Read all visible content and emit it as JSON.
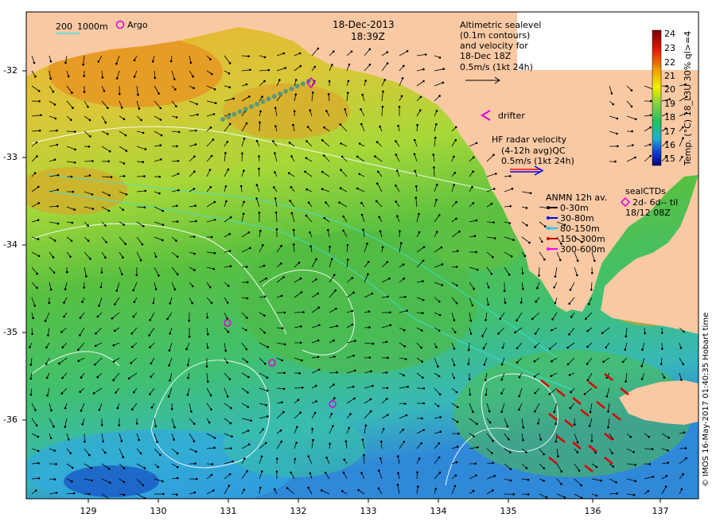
{
  "header": {
    "date": "18-Dec-2013",
    "time": "18:39Z"
  },
  "legend_isobath": {
    "depth1": "200",
    "depth2": "1000m"
  },
  "legend_argo": {
    "label": "Argo"
  },
  "altimetry_note": {
    "lines": [
      "Altimetric sealevel",
      "(0.1m contours)",
      "and velocity for",
      "18-Dec 18Z",
      "0.5m/s (1kt 24h)"
    ]
  },
  "drifter_legend": {
    "label": "drifter"
  },
  "hf_radar": {
    "lines": [
      "HF radar velocity",
      "(4-12h avg)QC",
      "0.5m/s (1kt 24h)"
    ]
  },
  "anmn": {
    "title": "ANMN 12h av.",
    "items": [
      {
        "label": "0-30m",
        "color": "#000000"
      },
      {
        "label": "30-80m",
        "color": "#0000ff"
      },
      {
        "label": "80-150m",
        "color": "#00c8ff"
      },
      {
        "label": "150-300m",
        "color": "#cc0000"
      },
      {
        "label": "300-600m",
        "color": "#ff00ff"
      }
    ]
  },
  "seal_ctds": {
    "title": "sealCTDs",
    "line2": "2d- 6d-- til",
    "line3": "18/12 08Z"
  },
  "colorbar": {
    "title": "Temp. (°C) 18_L3U 30% ql>=4",
    "ticks": [
      "24",
      "23",
      "22",
      "21",
      "20",
      "19",
      "18",
      "17",
      "16",
      "15"
    ]
  },
  "copyright": "© IMOS 16-May-2017 01:40:35 Hobart time",
  "axes": {
    "lon_ticks": [
      "129",
      "130",
      "131",
      "132",
      "133",
      "134",
      "135",
      "136",
      "137"
    ],
    "lat_ticks": [
      "-32",
      "-33",
      "-34",
      "-35",
      "-36"
    ]
  },
  "colors": {
    "land": "#f9c9a4",
    "warm_sst": "#e8a020",
    "mid_sst": "#60c040",
    "cool_sst": "#30c0b0",
    "contour": "#ffffff",
    "isobath": "#40e0e0",
    "argo": "#dd00dd",
    "glider_track": "#5a9a7a",
    "radar_arrows": "#dd0000"
  }
}
